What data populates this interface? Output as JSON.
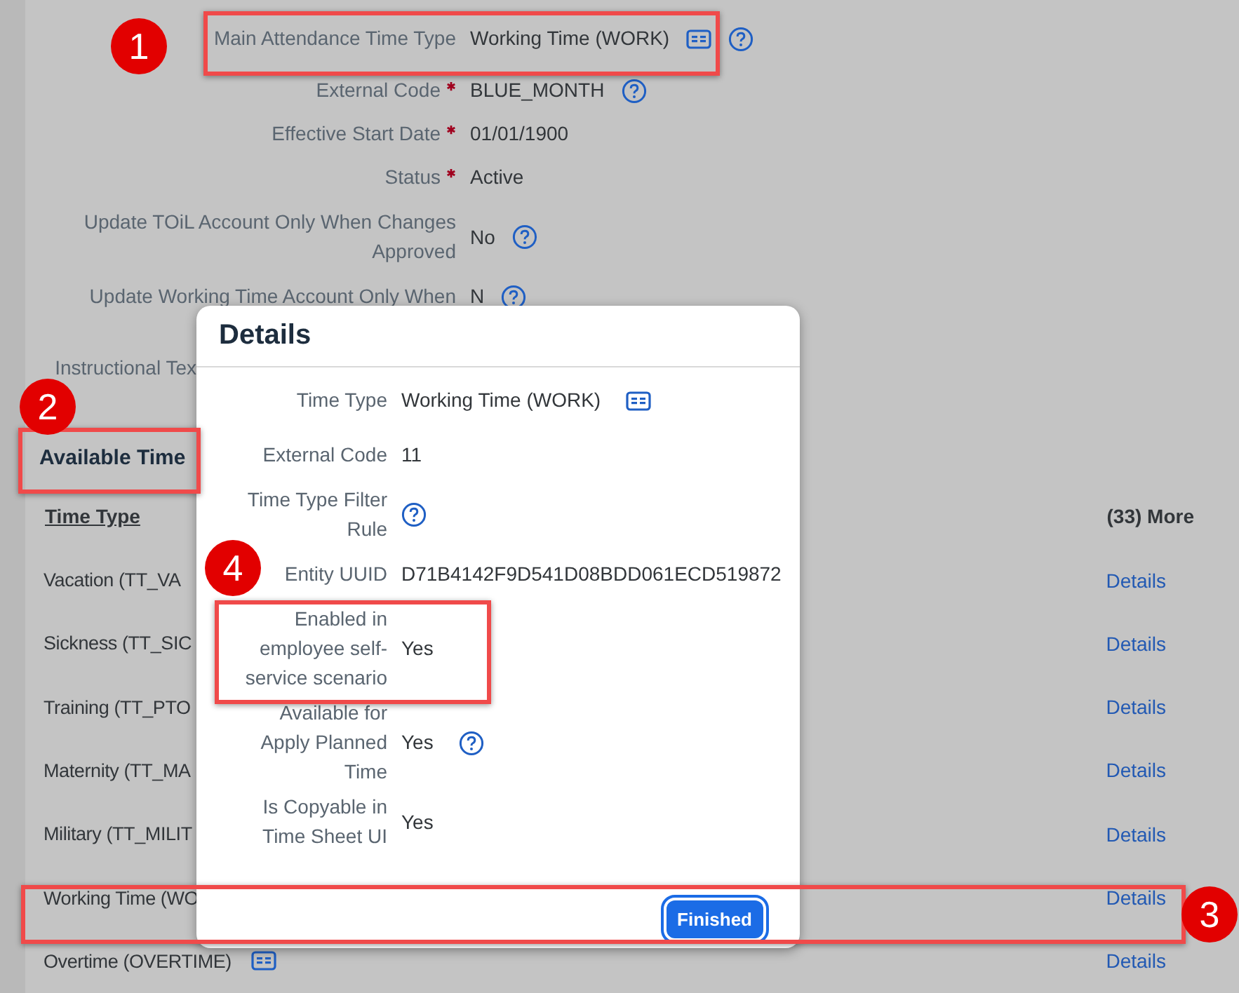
{
  "form": {
    "fields": [
      {
        "label": "Main Attendance Time Type",
        "required": false,
        "value": "Working Time (WORK)",
        "value_icon": true,
        "help": true
      },
      {
        "label": "External Code",
        "required": true,
        "value": "BLUE_MONTH",
        "value_icon": false,
        "help": true
      },
      {
        "label": "Effective Start Date",
        "required": true,
        "value": "01/01/1900",
        "value_icon": false,
        "help": false
      },
      {
        "label": "Status",
        "required": true,
        "value": "Active",
        "value_icon": false,
        "help": false
      },
      {
        "label": "Update TOiL Account Only When Changes Approved",
        "required": false,
        "value": "No",
        "value_icon": false,
        "help": true
      },
      {
        "label": "Update Working Time Account Only When",
        "required": false,
        "value": "N",
        "value_icon": false,
        "help": true
      },
      {
        "label": "Instructional Tex",
        "required": false,
        "value_icon": false,
        "help": false
      }
    ]
  },
  "section": {
    "title": "Available Time"
  },
  "table": {
    "columns": [
      "Time Type",
      "(33) More"
    ],
    "rows": [
      {
        "time_type": "Vacation (TT_VA",
        "icon": false,
        "link": "Details"
      },
      {
        "time_type": "Sickness (TT_SIC",
        "icon": false,
        "link": "Details"
      },
      {
        "time_type": "Training (TT_PTO",
        "icon": false,
        "link": "Details"
      },
      {
        "time_type": "Maternity (TT_MA",
        "icon": false,
        "link": "Details"
      },
      {
        "time_type": "Military (TT_MILIT",
        "icon": false,
        "link": "Details"
      },
      {
        "time_type": "Working Time (WO",
        "icon": false,
        "link": "Details"
      },
      {
        "time_type": "Overtime (OVERTIME)",
        "icon": true,
        "link": "Details"
      }
    ]
  },
  "dialog": {
    "title": "Details",
    "fields": [
      {
        "label": "Time Type",
        "value": "Working Time (WORK)",
        "value_icon": true,
        "help": false
      },
      {
        "label": "External Code",
        "value": "11",
        "value_icon": false,
        "help": false
      },
      {
        "label": "Time Type Filter Rule",
        "value_icon": false,
        "help": true
      },
      {
        "label": "Entity UUID",
        "value": "D71B4142F9D541D08BDD061ECD519872",
        "value_icon": false,
        "help": false
      },
      {
        "label": "Enabled in employee self-service scenario",
        "value": "Yes",
        "value_icon": false,
        "help": false
      },
      {
        "label": "Available for Apply Planned Time",
        "value": "Yes",
        "value_icon": false,
        "help": true
      },
      {
        "label": "Is Copyable in Time Sheet UI",
        "value": "Yes",
        "value_icon": false,
        "help": false
      }
    ],
    "button": "Finished"
  },
  "callouts": [
    {
      "number": "1"
    },
    {
      "number": "2"
    },
    {
      "number": "3"
    },
    {
      "number": "4"
    }
  ]
}
